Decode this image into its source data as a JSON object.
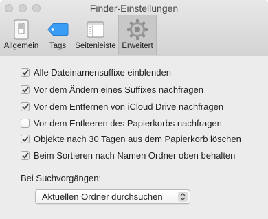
{
  "window": {
    "title": "Finder-Einstellungen"
  },
  "toolbar": {
    "tabs": [
      {
        "label": "Allgemein",
        "icon": "switch-icon",
        "selected": false
      },
      {
        "label": "Tags",
        "icon": "tag-icon",
        "selected": false
      },
      {
        "label": "Seitenleiste",
        "icon": "sidebar-icon",
        "selected": false
      },
      {
        "label": "Erweitert",
        "icon": "gear-icon",
        "selected": true
      }
    ]
  },
  "options": [
    {
      "label": "Alle Dateinamensuffixe einblenden",
      "checked": true
    },
    {
      "label": "Vor dem Ändern eines Suffixes nachfragen",
      "checked": true
    },
    {
      "label": "Vor dem Entfernen von iCloud Drive nachfragen",
      "checked": true
    },
    {
      "label": "Vor dem Entleeren des Papierkorbs nachfragen",
      "checked": false
    },
    {
      "label": "Objekte nach 30 Tagen aus dem Papierkorb löschen",
      "checked": true
    },
    {
      "label": "Beim Sortieren nach Namen Ordner oben behalten",
      "checked": true
    }
  ],
  "search": {
    "label": "Bei Suchvorgängen:",
    "selected_option": "Aktuellen Ordner durchsuchen"
  },
  "colors": {
    "window_bg": "#ececec",
    "tag_blue": "#3a9cf4",
    "selected_tab_bg": "#c8c8c8"
  }
}
